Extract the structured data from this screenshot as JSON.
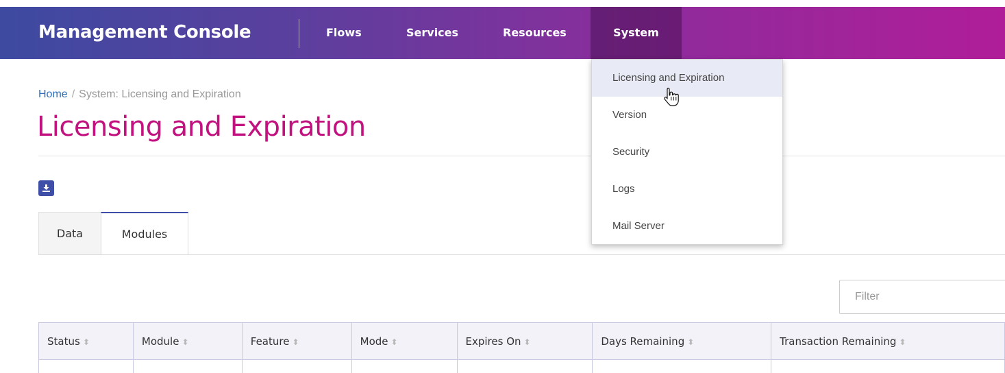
{
  "header": {
    "brand": "Management Console",
    "nav": [
      {
        "label": "Flows"
      },
      {
        "label": "Services"
      },
      {
        "label": "Resources"
      },
      {
        "label": "System",
        "active": true
      }
    ]
  },
  "breadcrumb": {
    "home": "Home",
    "separator": "/",
    "current": "System: Licensing and Expiration"
  },
  "page": {
    "title": "Licensing and Expiration",
    "download_icon": "download-icon"
  },
  "tabs": [
    {
      "label": "Data",
      "active": false
    },
    {
      "label": "Modules",
      "active": true
    }
  ],
  "filter": {
    "placeholder": "Filter",
    "value": ""
  },
  "table": {
    "columns": [
      "Status",
      "Module",
      "Feature",
      "Mode",
      "Expires On",
      "Days Remaining",
      "Transaction Remaining"
    ],
    "sort_icon": "sort-icon"
  },
  "system_menu": {
    "items": [
      {
        "label": "Licensing and Expiration",
        "hovered": true
      },
      {
        "label": "Version"
      },
      {
        "label": "Security"
      },
      {
        "label": "Logs"
      },
      {
        "label": "Mail Server"
      }
    ]
  },
  "colors": {
    "title": "#c2127f",
    "link": "#2f6fb6",
    "accent": "#3f4fa7",
    "header_gradient_start": "#3d4aa0",
    "header_gradient_end": "#b01d99"
  }
}
